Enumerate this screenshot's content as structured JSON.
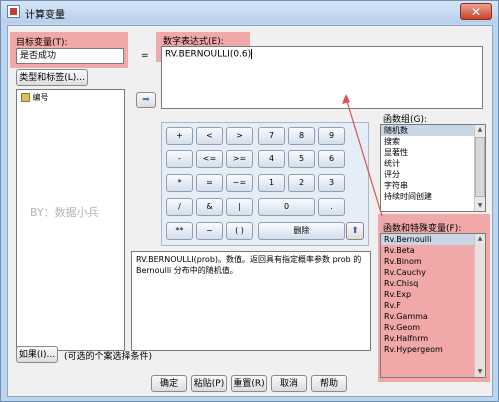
{
  "title": "计算变量",
  "close_glyph": "✕",
  "target_var": {
    "label": "目标变量(T):",
    "value": "是否成功"
  },
  "equals": "=",
  "type_label_button": "类型和标签(L)...",
  "var_list": {
    "items": [
      "编号"
    ]
  },
  "expr": {
    "label": "数字表达式(E):",
    "value": "RV.BERNOULLI(0.6)"
  },
  "keypad": {
    "rows": [
      [
        "+",
        "<",
        ">",
        "7",
        "8",
        "9"
      ],
      [
        "-",
        "<=",
        ">=",
        "4",
        "5",
        "6"
      ],
      [
        "*",
        "=",
        "~=",
        "1",
        "2",
        "3"
      ],
      [
        "/",
        "&",
        "|",
        "0",
        "."
      ],
      [
        "**",
        "~",
        "( )",
        "删除"
      ]
    ]
  },
  "watermark": "BY：数据小兵",
  "description": "RV.BERNOULLI(prob)。数值。返回具有指定概率参数 prob 的 Bernoulli 分布中的随机值。",
  "func_group": {
    "label": "函数组(G):",
    "items": [
      "随机数",
      "搜索",
      "显著性",
      "统计",
      "评分",
      "字符串",
      "持续时间创建"
    ]
  },
  "func_vars": {
    "label": "函数和特殊变量(F):",
    "items": [
      "Rv.Bernoulli",
      "Rv.Beta",
      "Rv.Binom",
      "Rv.Cauchy",
      "Rv.Chisq",
      "Rv.Exp",
      "Rv.F",
      "Rv.Gamma",
      "Rv.Geom",
      "Rv.Halfnrm",
      "Rv.Hypergeom"
    ]
  },
  "if_button": "如果(I)...",
  "if_note": "(可选的个案选择条件)",
  "buttons": {
    "ok": "确定",
    "paste": "粘贴(P)",
    "reset": "重置(R)",
    "cancel": "取消",
    "help": "帮助"
  },
  "colors": {
    "highlight": "#f06e6e",
    "title_bar": "#c8dcf2",
    "frame": "#bcd4ec"
  }
}
